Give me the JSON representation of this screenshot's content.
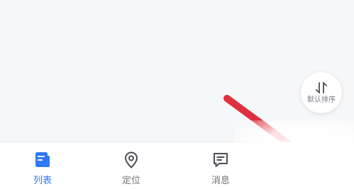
{
  "sort_button": {
    "label": "默认排序",
    "icon": "sort-arrows-icon"
  },
  "tabbar": {
    "active_color": "#2f7af4",
    "inactive_color": "#6e7177",
    "tabs": [
      {
        "label": "列表",
        "icon": "list-document-icon",
        "active": true
      },
      {
        "label": "定位",
        "icon": "location-pin-icon",
        "active": false
      },
      {
        "label": "消息",
        "icon": "message-bubble-icon",
        "active": false
      }
    ]
  },
  "annotation": {
    "arrow_color": "#e0303f"
  }
}
